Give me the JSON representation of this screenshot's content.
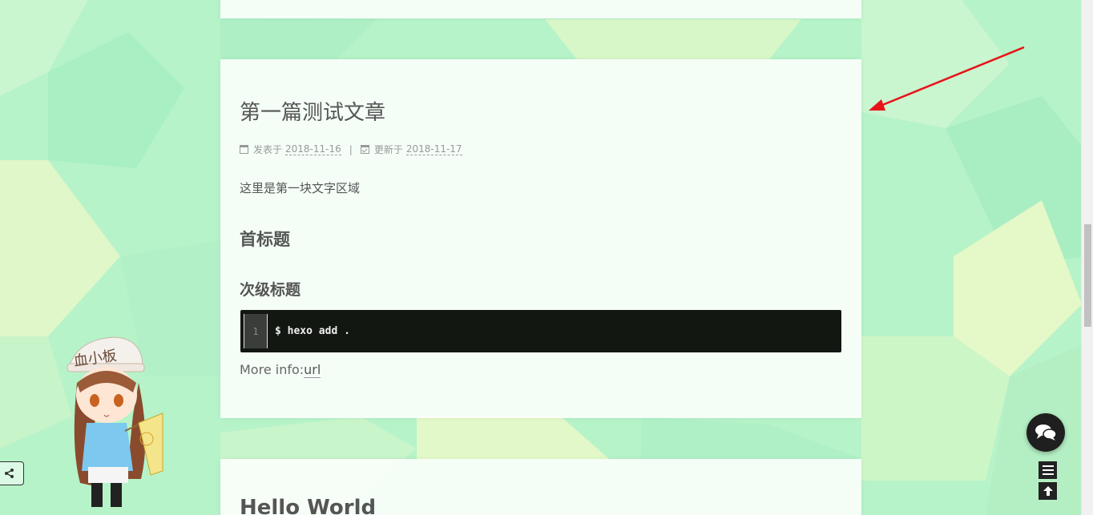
{
  "post": {
    "title": "第一篇测试文章",
    "meta": {
      "posted_label": "发表于",
      "posted_date": "2018-11-16",
      "separator": "|",
      "updated_label": "更新于",
      "updated_date": "2018-11-17"
    },
    "paragraph": "这里是第一块文字区域",
    "heading1": "首标题",
    "heading2": "次级标题",
    "code": {
      "line_number": "1",
      "line": "$ hexo add ."
    },
    "more_info_label": "More info:",
    "more_info_link": "url"
  },
  "next_post": {
    "title": "Hello World"
  },
  "mascot": {
    "hat_text": "血小板"
  },
  "icons": {
    "posted": "calendar-icon",
    "updated": "calendar-check-icon",
    "share": "share-icon",
    "chat": "comments-icon",
    "menu": "menu-icon",
    "back_to_top": "arrow-up-icon"
  },
  "colors": {
    "annotation_arrow": "#e8141a",
    "background": "#b9f2cc",
    "code_bg": "#121712"
  }
}
